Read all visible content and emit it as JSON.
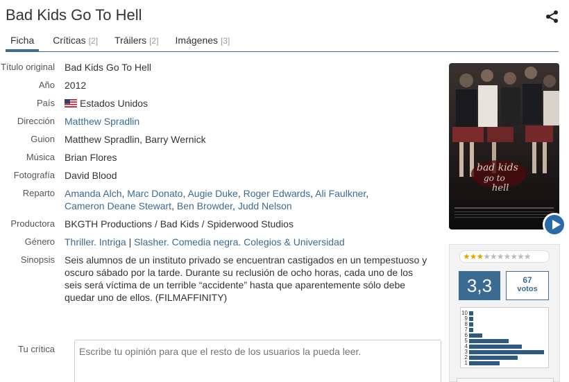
{
  "header": {
    "title": "Bad Kids Go To Hell"
  },
  "tabs": [
    {
      "label": "Ficha",
      "count": ""
    },
    {
      "label": "Críticas",
      "count": "[2]"
    },
    {
      "label": "Tráilers",
      "count": "[2]"
    },
    {
      "label": "Imágenes",
      "count": "[3]"
    }
  ],
  "details": {
    "titulo_original": {
      "label": "Título original",
      "value": "Bad Kids Go To Hell"
    },
    "anio": {
      "label": "Año",
      "value": "2012"
    },
    "pais": {
      "label": "País",
      "value": "Estados Unidos"
    },
    "direccion": {
      "label": "Dirección",
      "value": "Matthew Spradlin"
    },
    "guion": {
      "label": "Guion",
      "value": "Matthew Spradlin, Barry Wernick"
    },
    "musica": {
      "label": "Música",
      "value": "Brian Flores"
    },
    "fotografia": {
      "label": "Fotografía",
      "value": "David Blood"
    },
    "reparto": {
      "label": "Reparto",
      "actors": [
        "Amanda Alch",
        "Marc Donato",
        "Augie Duke",
        "Roger Edwards",
        "Ali Faulkner",
        "Cameron Deane Stewart",
        "Ben Browder",
        "Judd Nelson"
      ]
    },
    "productora": {
      "label": "Productora",
      "value": "BKGTH Productions / Bad Kids / Spiderwood Studios"
    },
    "genero": {
      "label": "Género",
      "main": [
        "Thriller",
        "Intriga"
      ],
      "sub": [
        "Slasher",
        "Comedia negra",
        "Colegios & Universidad"
      ]
    },
    "sinopsis": {
      "label": "Sinopsis",
      "value": "Seis alumnos de un instituto privado se encuentran castigados en un tempestuoso y oscuro sábado por la tarde. Durante su reclusión de ocho horas, cada uno de los seis será víctima de un terrible “accidente” hasta que aparentemente sólo debe quedar uno de ellos. (FILMAFFINITY)"
    }
  },
  "review": {
    "label": "Tu crítica",
    "placeholder": "Escribe tu opinión para que el resto de los usuarios la pueda leer."
  },
  "rating": {
    "score": "3,3",
    "votes": "67",
    "votes_label": "votos",
    "stars_filled": 3,
    "stars_total": 10,
    "histogram": [
      {
        "label": "10",
        "value": 1
      },
      {
        "label": "9",
        "value": 1
      },
      {
        "label": "8",
        "value": 1
      },
      {
        "label": "7",
        "value": 1
      },
      {
        "label": "6",
        "value": 3
      },
      {
        "label": "5",
        "value": 9
      },
      {
        "label": "4",
        "value": 12
      },
      {
        "label": "3",
        "value": 17
      },
      {
        "label": "2",
        "value": 11
      },
      {
        "label": "1",
        "value": 7
      }
    ]
  },
  "colors": {
    "accent": "#3b6a93",
    "star": "#e1a800"
  }
}
